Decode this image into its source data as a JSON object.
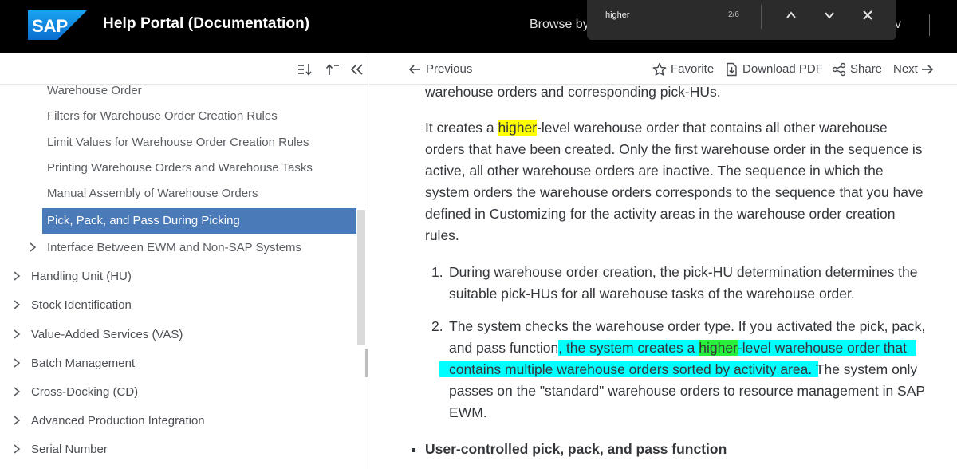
{
  "header": {
    "logo_text": "SAP",
    "title": "Help Portal (Documentation)",
    "browse_label": "Browse by",
    "browse_tail": "v",
    "brand_color": "#1a8fe0"
  },
  "find_bar": {
    "query": "higher",
    "match_count": "2/6",
    "prev_icon": "chevron-up-icon",
    "next_icon": "chevron-down-icon",
    "close_icon": "close-icon"
  },
  "left_toolbar": {
    "icons": [
      "expand-all-icon",
      "collapse-up-icon",
      "collapse-sidebar-icon"
    ]
  },
  "nav": {
    "items": [
      {
        "label": "Warehouse Order",
        "level": 2,
        "has_children": false
      },
      {
        "label": "Filters for Warehouse Order Creation Rules",
        "level": 2,
        "has_children": false
      },
      {
        "label": "Limit Values for Warehouse Order Creation Rules",
        "level": 2,
        "has_children": false
      },
      {
        "label": "Printing Warehouse Orders and Warehouse Tasks",
        "level": 2,
        "has_children": false
      },
      {
        "label": "Manual Assembly of Warehouse Orders",
        "level": 2,
        "has_children": false
      },
      {
        "label": "Pick, Pack, and Pass During Picking",
        "level": 2,
        "has_children": false,
        "selected": true
      },
      {
        "label": "Interface Between EWM and Non-SAP Systems",
        "level": 2,
        "has_children": true
      },
      {
        "label": "Handling Unit (HU)",
        "level": 1,
        "has_children": true
      },
      {
        "label": "Stock Identification",
        "level": 1,
        "has_children": true
      },
      {
        "label": "Value-Added Services (VAS)",
        "level": 1,
        "has_children": true
      },
      {
        "label": "Batch Management",
        "level": 1,
        "has_children": true
      },
      {
        "label": "Cross-Docking (CD)",
        "level": 1,
        "has_children": true
      },
      {
        "label": "Advanced Production Integration",
        "level": 1,
        "has_children": true
      },
      {
        "label": "Serial Number",
        "level": 1,
        "has_children": true
      }
    ],
    "selected_color": "#4a7ab8"
  },
  "right_toolbar": {
    "previous_label": "Previous",
    "favorite_label": "Favorite",
    "download_label": "Download PDF",
    "share_label": "Share",
    "next_label": "Next"
  },
  "content": {
    "top_line": "warehouse orders and corresponding pick-HUs.",
    "p1_before": "It creates a ",
    "p1_hit": "higher",
    "p1_line1_after": "-level warehouse order that contains all other warehouse",
    "p1_line2": "orders that have been created. Only the first warehouse order in the sequence is",
    "p1_line3": "active, all other warehouse orders are inactive. The sequence in which the",
    "p1_line4": "system orders the warehouse orders corresponds to the sequence that you have",
    "p1_line5": "defined in Customizing for the activity areas in the warehouse order creation",
    "p1_line6": "rules.",
    "steps": [
      {
        "num": "1.",
        "line1": "During warehouse order creation, the pick-HU determination determines the",
        "line2": "suitable pick-HUs for all warehouse tasks of the warehouse order."
      },
      {
        "num": "2.",
        "line1": "The system checks the warehouse order type. If you activated the pick, pack,",
        "line2_plain": "and pass function",
        "line2_sel_a": ", the system creates a ",
        "line2_hit": "higher",
        "line2_sel_b": "-level warehouse order that",
        "line3_sel": "contains multiple warehouse orders sorted by activity area.",
        "line3_plain": " The system only",
        "line4": "passes on the \"standard\" warehouse orders to resource management in SAP",
        "line5": "EWM."
      }
    ],
    "bullet_heading": "User-controlled pick, pack, and pass function",
    "highlight_colors": {
      "match": "#ffff00",
      "current_match": "#26f03c",
      "selection": "#00ffff"
    }
  }
}
